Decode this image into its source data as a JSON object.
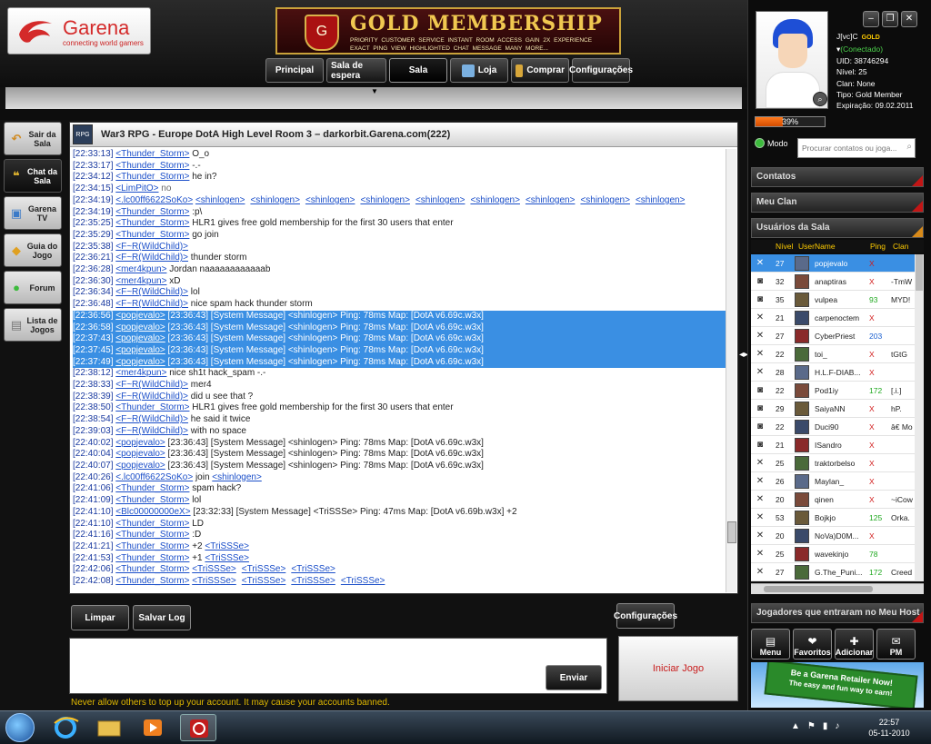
{
  "app": {
    "logo_name": "Garena",
    "logo_tagline": "connecting world gamers"
  },
  "banner": {
    "title": "GOLD MEMBERSHIP",
    "perks": "PRIORITY CUSTOMER SERVICE   INSTANT ROOM ACCESS   GAIN 2X EXPERIENCE   EXACT PING VIEW   HIGHLIGHTED CHAT MESSAGE   MANY MORE..."
  },
  "nav": [
    "Principal",
    "Sala de espera",
    "Sala",
    "Loja",
    "Comprar",
    "Configurações"
  ],
  "sidebar": [
    {
      "label": "Sair da Sala",
      "icon": "exit-icon"
    },
    {
      "label": "Chat da Sala",
      "icon": "chat-icon"
    },
    {
      "label": "Garena TV",
      "icon": "tv-icon"
    },
    {
      "label": "Guia do Jogo",
      "icon": "guide-icon"
    },
    {
      "label": "Forum",
      "icon": "forum-icon"
    },
    {
      "label": "Lista de Jogos",
      "icon": "list-icon"
    }
  ],
  "room": {
    "badge": "RPG",
    "title": "War3 RPG - Europe DotA High Level Room 3 – darkorbit.Garena.com(222)"
  },
  "chat": [
    {
      "ts": "[22:33:13]",
      "user": "<Thunder_Storm>",
      "msg": "O_o",
      "links": []
    },
    {
      "ts": "[22:33:17]",
      "user": "<Thunder_Storm>",
      "msg": "-.-",
      "links": []
    },
    {
      "ts": "[22:34:12]",
      "user": "<Thunder_Storm>",
      "msg": "he in?",
      "links": []
    },
    {
      "ts": "[22:34:15]",
      "user": "<LimPitO>",
      "msg": "no",
      "links": [],
      "gray": true
    },
    {
      "ts": "[22:34:19]",
      "user": "<.lc00ff6622SoKo>",
      "msg": "",
      "links": [
        "<shinlogen>",
        "<shinlogen>",
        "<shinlogen>",
        "<shinlogen>",
        "<shinlogen>",
        "<shinlogen>",
        "<shinlogen>",
        "<shinlogen>",
        "<shinlogen>"
      ]
    },
    {
      "ts": "[22:34:19]",
      "user": "<Thunder_Storm>",
      "msg": ":p\\",
      "links": []
    },
    {
      "ts": "[22:35:25]",
      "user": "<Thunder_Storm>",
      "msg": "HLR1 gives free gold membership for the first 30 users that enter",
      "links": []
    },
    {
      "ts": "[22:35:29]",
      "user": "<Thunder_Storm>",
      "msg": "go join",
      "links": []
    },
    {
      "ts": "[22:35:38]",
      "user": "<F~R(WildChild)>",
      "msg": "",
      "links": []
    },
    {
      "ts": "[22:36:21]",
      "user": "<F~R(WildChild)>",
      "msg": "thunder storm",
      "links": []
    },
    {
      "ts": "[22:36:28]",
      "user": "<mer4kpun>",
      "msg": "Jordan naaaaaaaaaaaab",
      "links": []
    },
    {
      "ts": "[22:36:30]",
      "user": "<mer4kpun>",
      "msg": "xD",
      "links": []
    },
    {
      "ts": "[22:36:34]",
      "user": "<F~R(WildChild)>",
      "msg": "lol",
      "links": []
    },
    {
      "ts": "[22:36:48]",
      "user": "<F~R(WildChild)>",
      "msg": "nice spam hack thunder storm",
      "links": []
    },
    {
      "ts": "[22:36:56]",
      "user": "<popjevalo>",
      "msg": "[23:36:43] [System Message] <shinlogen>  Ping: 78ms  Map: [DotA v6.69c.w3x]",
      "links": [],
      "sel": true
    },
    {
      "ts": "[22:36:58]",
      "user": "<popjevalo>",
      "msg": "[23:36:43] [System Message] <shinlogen>  Ping: 78ms  Map: [DotA v6.69c.w3x]",
      "links": [],
      "sel": true
    },
    {
      "ts": "[22:37:43]",
      "user": "<popjevalo>",
      "msg": "[23:36:43] [System Message] <shinlogen>  Ping: 78ms  Map: [DotA v6.69c.w3x]",
      "links": [],
      "sel": true
    },
    {
      "ts": "[22:37:45]",
      "user": "<popjevalo>",
      "msg": "[23:36:43] [System Message] <shinlogen>  Ping: 78ms  Map: [DotA v6.69c.w3x]",
      "links": [],
      "sel": true
    },
    {
      "ts": "[22:37:49]",
      "user": "<popjevalo>",
      "msg": "[23:36:43] [System Message] <shinlogen>  Ping: 78ms  Map: [DotA v6.69c.w3x]",
      "links": [],
      "sel": true
    },
    {
      "ts": "[22:38:12]",
      "user": "<mer4kpun>",
      "msg": "nice sh1t hack_spam -.-",
      "links": []
    },
    {
      "ts": "[22:38:33]",
      "user": "<F~R(WildChild)>",
      "msg": "mer4",
      "links": []
    },
    {
      "ts": "[22:38:39]",
      "user": "<F~R(WildChild)>",
      "msg": "did u see that ?",
      "links": []
    },
    {
      "ts": "[22:38:50]",
      "user": "<Thunder_Storm>",
      "msg": "HLR1 gives free gold membership for the first 30 users that enter",
      "links": []
    },
    {
      "ts": "[22:38:54]",
      "user": "<F~R(WildChild)>",
      "msg": "he said it twice",
      "links": []
    },
    {
      "ts": "[22:39:03]",
      "user": "<F~R(WildChild)>",
      "msg": "with no space",
      "links": []
    },
    {
      "ts": "[22:40:02]",
      "user": "<popjevalo>",
      "msg": "[23:36:43] [System Message] <shinlogen>  Ping: 78ms  Map: [DotA v6.69c.w3x]",
      "links": []
    },
    {
      "ts": "[22:40:04]",
      "user": "<popjevalo>",
      "msg": "[23:36:43] [System Message] <shinlogen>  Ping: 78ms  Map: [DotA v6.69c.w3x]",
      "links": []
    },
    {
      "ts": "[22:40:07]",
      "user": "<popjevalo>",
      "msg": "[23:36:43] [System Message] <shinlogen>  Ping: 78ms  Map: [DotA v6.69c.w3x]",
      "links": []
    },
    {
      "ts": "[22:40:26]",
      "user": "<.lc00ff6622SoKo>",
      "msg": "join",
      "links": [
        "<shinlogen>"
      ]
    },
    {
      "ts": "[22:41:06]",
      "user": "<Thunder_Storm>",
      "msg": "spam hack?",
      "links": []
    },
    {
      "ts": "[22:41:09]",
      "user": "<Thunder_Storm>",
      "msg": "lol",
      "links": []
    },
    {
      "ts": "[22:41:10]",
      "user": "<Blc00000000eX>",
      "msg": "[23:32:33] [System Message] <TriSSSe>  Ping: 47ms  Map: [DotA v6.69b.w3x] +2",
      "links": []
    },
    {
      "ts": "[22:41:10]",
      "user": "<Thunder_Storm>",
      "msg": "LD",
      "links": []
    },
    {
      "ts": "[22:41:16]",
      "user": "<Thunder_Storm>",
      "msg": ":D",
      "links": []
    },
    {
      "ts": "[22:41:21]",
      "user": "<Thunder_Storm>",
      "msg": "+2",
      "links": [
        "<TriSSSe>"
      ]
    },
    {
      "ts": "[22:41:53]",
      "user": "<Thunder_Storm>",
      "msg": "+1",
      "links": [
        "<TriSSSe>"
      ]
    },
    {
      "ts": "[22:42:06]",
      "user": "<Thunder_Storm>",
      "msg": "",
      "links": [
        "<TriSSSe>",
        "<TriSSSe>",
        "<TriSSSe>"
      ]
    },
    {
      "ts": "[22:42:08]",
      "user": "<Thunder_Storm>",
      "msg": "",
      "links": [
        "<TriSSSe>",
        "<TriSSSe>",
        "<TriSSSe>",
        "<TriSSSe>"
      ]
    }
  ],
  "tools": {
    "limpar": "Limpar",
    "salvar": "Salvar Log",
    "config": "Configurações",
    "enviar": "Enviar",
    "iniciar": "Iniciar Jogo"
  },
  "input": {
    "value": "",
    "placeholder": ""
  },
  "warning": "Never allow others to top up your account. It may cause your accounts banned.",
  "profile": {
    "name": "J[vc]C",
    "badge": "GOLD",
    "status": "(Conectado)",
    "uid": "UID: 38746294",
    "nivel": "Nível: 25",
    "clan": "Clan: None",
    "tipo": "Tipo: Gold Member",
    "expiracao": "Expiração: 09.02.2011",
    "xp_percent": 39,
    "xp_label": "39%"
  },
  "modo": "Modo",
  "search": {
    "placeholder": "Procurar contatos ou joga..."
  },
  "sections": {
    "contatos": "Contatos",
    "clan": "Meu Clan",
    "usuarios": "Usuários da Sala",
    "jogadores": "Jogadores que entraram no Meu Host"
  },
  "userlist": {
    "headers": {
      "nivel": "Nível",
      "username": "UserName",
      "ping": "Ping",
      "clan": "Clan"
    },
    "rows": [
      {
        "icon": "sword-icon",
        "lv": "27",
        "name": "popjevalo",
        "ping": "X",
        "pc": "x",
        "clan": ""
      },
      {
        "icon": "chat-bubble-icon",
        "lv": "32",
        "name": "anaptiras",
        "ping": "X",
        "pc": "x",
        "clan": "-TmW"
      },
      {
        "icon": "chat-bubble-icon",
        "lv": "35",
        "name": "vulpea",
        "ping": "93",
        "pc": "g",
        "clan": "MYD!"
      },
      {
        "icon": "sword-icon",
        "lv": "21",
        "name": "carpenoctem",
        "ping": "X",
        "pc": "x",
        "clan": ""
      },
      {
        "icon": "sword-icon",
        "lv": "27",
        "name": "CyberPriest",
        "ping": "203",
        "pc": "b",
        "clan": ""
      },
      {
        "icon": "sword-icon",
        "lv": "22",
        "name": "toi_",
        "ping": "X",
        "pc": "x",
        "clan": "tGtG"
      },
      {
        "icon": "sword-icon",
        "lv": "28",
        "name": "H.L.F-DIAB...",
        "ping": "X",
        "pc": "x",
        "clan": ""
      },
      {
        "icon": "chat-bubble-icon",
        "lv": "22",
        "name": "Pod1iy",
        "ping": "172",
        "pc": "g",
        "clan": "[.i.]"
      },
      {
        "icon": "chat-bubble-icon",
        "lv": "29",
        "name": "SaiyaNN",
        "ping": "X",
        "pc": "x",
        "clan": "hP."
      },
      {
        "icon": "chat-bubble-icon",
        "lv": "22",
        "name": "Duci90",
        "ping": "X",
        "pc": "x",
        "clan": "â€ Mo"
      },
      {
        "icon": "chat-bubble-icon",
        "lv": "21",
        "name": "ISandro",
        "ping": "X",
        "pc": "x",
        "clan": ""
      },
      {
        "icon": "sword-icon",
        "lv": "25",
        "name": "traktorbelso",
        "ping": "X",
        "pc": "x",
        "clan": ""
      },
      {
        "icon": "sword-icon",
        "lv": "26",
        "name": "Maylan_",
        "ping": "X",
        "pc": "x",
        "clan": ""
      },
      {
        "icon": "sword-icon",
        "lv": "20",
        "name": "qinen",
        "ping": "X",
        "pc": "x",
        "clan": "~iCow"
      },
      {
        "icon": "sword-icon",
        "lv": "53",
        "name": "Bojkjo",
        "ping": "125",
        "pc": "g",
        "clan": "Orka."
      },
      {
        "icon": "sword-icon",
        "lv": "20",
        "name": "NoVa)D0M...",
        "ping": "X",
        "pc": "x",
        "clan": ""
      },
      {
        "icon": "sword-icon",
        "lv": "25",
        "name": "wavekinjo",
        "ping": "78",
        "pc": "g",
        "clan": ""
      },
      {
        "icon": "sword-icon",
        "lv": "27",
        "name": "G.The_Puni...",
        "ping": "172",
        "pc": "g",
        "clan": "Creed"
      }
    ]
  },
  "actions": [
    {
      "label": "Menu",
      "icon": "menu-icon",
      "glyph": "▤"
    },
    {
      "label": "Favoritos",
      "icon": "favorites-icon",
      "glyph": "❤"
    },
    {
      "label": "Adicionar",
      "icon": "add-user-icon",
      "glyph": "✚"
    },
    {
      "label": "PM",
      "icon": "pm-icon",
      "glyph": "✉"
    }
  ],
  "ad": {
    "line1": "Be a Garena Retailer Now!",
    "line2": "The easy and fun way to earn!"
  },
  "taskbar": {
    "time": "22:57",
    "date": "05-11-2010"
  },
  "colors": {
    "accent_red": "#c31515",
    "gold": "#ffcc00",
    "select_blue": "#3a8fe3",
    "online_green": "#4cd24c"
  }
}
